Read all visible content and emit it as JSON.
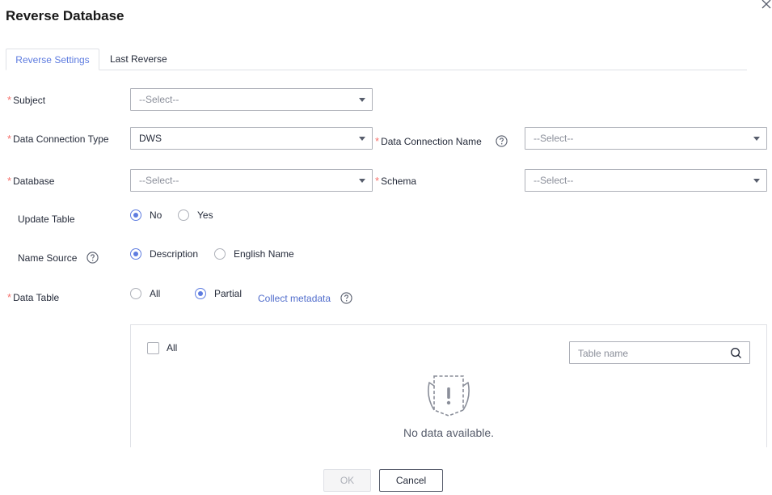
{
  "dialog": {
    "title": "Reverse Database",
    "close_icon": "close-icon"
  },
  "tabs": [
    {
      "label": "Reverse Settings",
      "active": true
    },
    {
      "label": "Last Reverse",
      "active": false
    }
  ],
  "form": {
    "required_mark": "*",
    "subject": {
      "label": "Subject",
      "placeholder": "--Select--"
    },
    "data_connection_type": {
      "label": "Data Connection Type",
      "value": "DWS"
    },
    "data_connection_name": {
      "label": "Data Connection Name",
      "placeholder": "--Select--"
    },
    "database": {
      "label": "Database",
      "placeholder": "--Select--"
    },
    "schema": {
      "label": "Schema",
      "placeholder": "--Select--"
    },
    "update_table": {
      "label": "Update Table",
      "options": [
        "No",
        "Yes"
      ],
      "selected": "No"
    },
    "name_source": {
      "label": "Name Source",
      "options": [
        "Description",
        "English Name"
      ],
      "selected": "Description"
    },
    "data_table": {
      "label": "Data Table",
      "options": [
        "All",
        "Partial"
      ],
      "selected": "Partial",
      "link": "Collect metadata"
    }
  },
  "table_panel": {
    "select_all_label": "All",
    "search_placeholder": "Table name",
    "empty_text": "No data available."
  },
  "footer": {
    "ok_label": "OK",
    "cancel_label": "Cancel"
  },
  "colors": {
    "accent": "#5e7ce0",
    "required": "#f66f6a",
    "link": "#526ecc"
  }
}
